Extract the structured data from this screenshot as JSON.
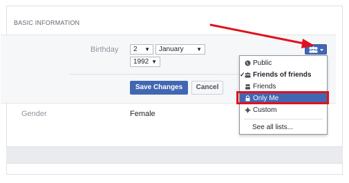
{
  "section": {
    "title": "BASIC INFORMATION"
  },
  "birthday": {
    "label": "Birthday",
    "day": "2",
    "month": "January",
    "year": "1992"
  },
  "actions": {
    "save_label": "Save Changes",
    "cancel_label": "Cancel"
  },
  "gender": {
    "label": "Gender",
    "value": "Female"
  },
  "privacy_menu": {
    "items": [
      {
        "label": "Public",
        "icon": "globe-icon"
      },
      {
        "label": "Friends of friends",
        "icon": "friends-of-friends-icon",
        "checked": true
      },
      {
        "label": "Friends",
        "icon": "friends-icon"
      },
      {
        "label": "Only Me",
        "icon": "lock-icon",
        "highlighted": true
      },
      {
        "label": "Custom",
        "icon": "gear-icon"
      }
    ],
    "see_all_label": "See all lists..."
  },
  "colors": {
    "accent": "#4267b2",
    "annotation": "#e0111c"
  }
}
